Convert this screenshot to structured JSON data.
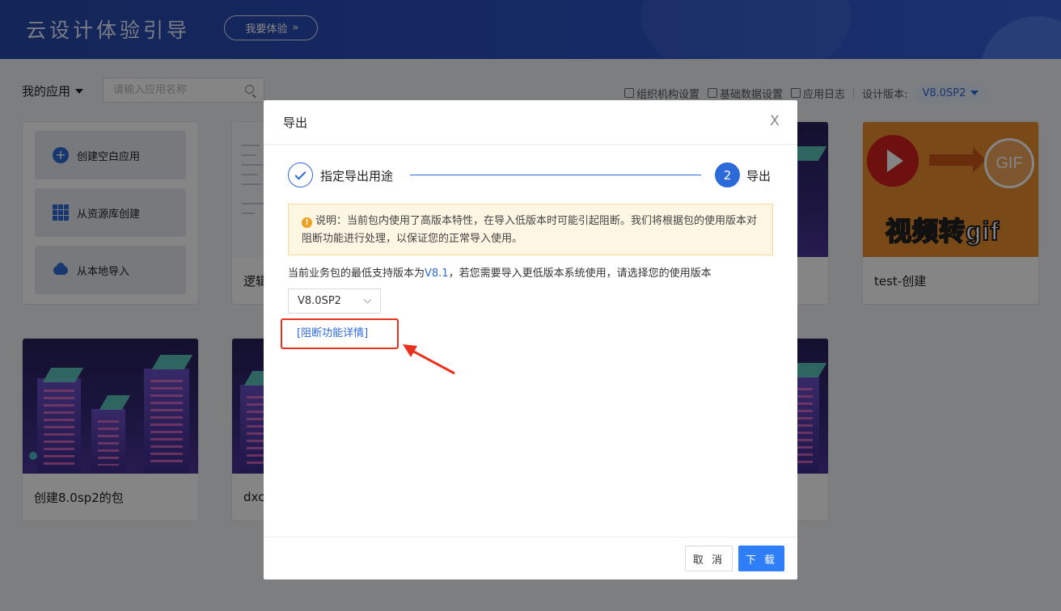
{
  "header": {
    "title": "云设计体验引导",
    "try_button": "我要体验",
    "try_button_icon": "double-chevron-right-icon"
  },
  "toolbar": {
    "my_apps": "我的应用",
    "search_placeholder": "请输入应用名称",
    "links": [
      "组织机构设置",
      "基础数据设置",
      "应用日志"
    ],
    "design_version_label": "设计版本:",
    "design_version_value": "V8.0SP2"
  },
  "create_actions": [
    "创建空白应用",
    "从资源库创建",
    "从本地导入"
  ],
  "cards": {
    "row1": [
      "逻辑",
      "test-创建"
    ],
    "row2": [
      "创建8.0sp2的包",
      "dxc"
    ]
  },
  "modal": {
    "title": "导出",
    "close_glyph": "X",
    "step1_label": "指定导出用途",
    "step2_number": "2",
    "step2_label": "导出",
    "notice": "说明：当前包内使用了高版本特性，在导入低版本时可能引起阻断。我们将根据包的使用版本对阻断功能进行处理，以保证您的正常导入使用。",
    "notice_icon": "!",
    "desc_prefix": "当前业务包的最低支持版本为",
    "desc_version": "V8.1",
    "desc_suffix": "，若您需要导入更低版本系统使用，请选择您的使用版本",
    "selected_version": "V8.0SP2",
    "detail_link": "[阻断功能详情]",
    "cancel_button": "取 消",
    "download_button": "下 载"
  },
  "colors": {
    "accent": "#2d6ad9",
    "primary_button": "#2d7ef7",
    "annotation": "#e8321e",
    "notice_bg": "#fdf6e3"
  }
}
